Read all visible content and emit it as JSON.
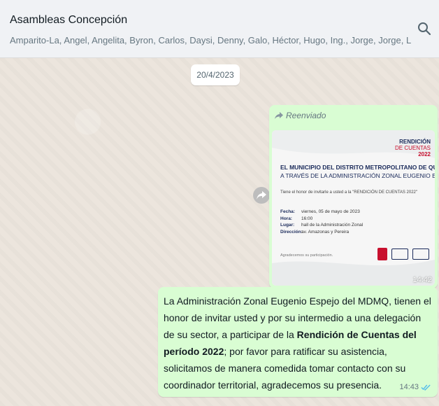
{
  "chat": {
    "group_name": "Asambleas Concepción",
    "members": "Amparito-La, Angel, Angelita, Byron, Carlos, Daysi, Denny, Galo, Héctor, Hugo, Ing., Jorge, Jorge, Luis, Ma., Marco, Maria, Moni, Mónic..."
  },
  "date_divider": "20/4/2023",
  "image_message": {
    "forwarded_label": "Reenviado",
    "time": "14:42",
    "card": {
      "brand_line1": "RENDICIÓN",
      "brand_line2": "DE CUENTAS",
      "brand_year": "2022",
      "title_line1": "EL MUNICIPIO DEL DISTRITO METROPOLITANO DE QUITO",
      "title_line2": "A TRAVÉS DE LA ADMINISTRACIÓN ZONAL EUGENIO ESPEJO",
      "invite_line": "Tiene el honor de invitarle a usted a la \"RENDICIÓN DE CUENTAS 2022\"",
      "fecha_label": "Fecha:",
      "fecha_value": "viernes, 05 de mayo de 2023",
      "hora_label": "Hora:",
      "hora_value": "16:00",
      "lugar_label": "Lugar:",
      "lugar_value": "hall de la Administración Zonal",
      "direccion_label": "Dirección:",
      "direccion_value": "av. Amazonas y Pereira",
      "footer": "Agradecemos su participación."
    }
  },
  "text_message": {
    "part1": "La Administración Zonal Eugenio Espejo del MDMQ, tienen el honor de invitar usted y  por su intermedio a una delegación de su sector, a participar de la ",
    "bold": "Rendición de Cuentas del período 2022",
    "part2": "; por favor para ratificar su asistencia, solicitamos de manera comedida tomar contacto con su coordinador territorial, agradecemos su presencia.",
    "time": "14:43"
  },
  "colors": {
    "outgoing_bubble": "#d9fdd3",
    "header_bg": "#f0f2f5",
    "read_ticks": "#53bdeb"
  },
  "icons": [
    "search-icon",
    "forward-icon",
    "share-icon",
    "double-check-icon"
  ]
}
